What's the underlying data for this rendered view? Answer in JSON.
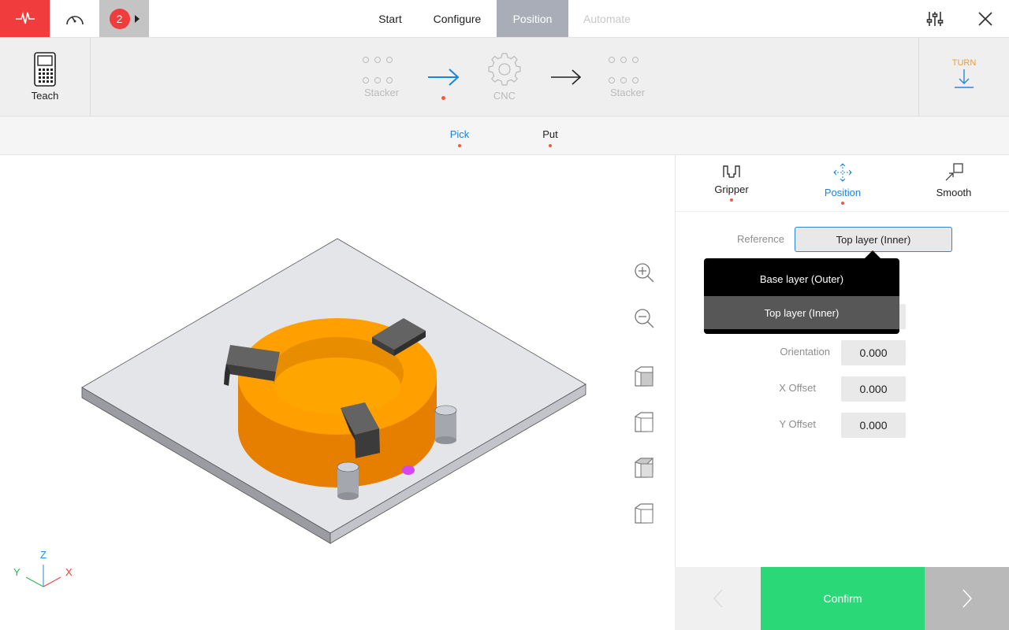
{
  "topbar": {
    "job_count": "2",
    "tabs": [
      {
        "label": "Start"
      },
      {
        "label": "Configure"
      },
      {
        "label": "Position"
      },
      {
        "label": "Automate"
      }
    ]
  },
  "cell": {
    "teach_label": "Teach",
    "stations": [
      "Stacker",
      "CNC",
      "Stacker"
    ],
    "turn_label": "TURN"
  },
  "subnav": {
    "tabs": [
      {
        "label": "Pick"
      },
      {
        "label": "Put"
      }
    ]
  },
  "panel": {
    "tabs": [
      {
        "label": "Gripper"
      },
      {
        "label": "Position"
      },
      {
        "label": "Smooth"
      }
    ],
    "reference_label": "Reference",
    "reference_value": "Top layer (Inner)",
    "dropdown_options": [
      "Base layer (Outer)",
      "Top layer (Inner)"
    ],
    "fields": [
      {
        "label": "Orientation",
        "value": "0.000"
      },
      {
        "label": "X Offset",
        "value": "0.000"
      },
      {
        "label": "Y Offset",
        "value": "0.000"
      }
    ]
  },
  "viewport": {
    "axis_labels": {
      "x": "X",
      "y": "Y",
      "z": "Z"
    }
  },
  "footer": {
    "confirm_label": "Confirm"
  },
  "colors": {
    "accent_blue": "#1b84dc",
    "status_red": "#f03c3c",
    "confirm_green": "#2bd878",
    "part_orange": "#ff9f00",
    "turn_orange": "#f39c29"
  }
}
